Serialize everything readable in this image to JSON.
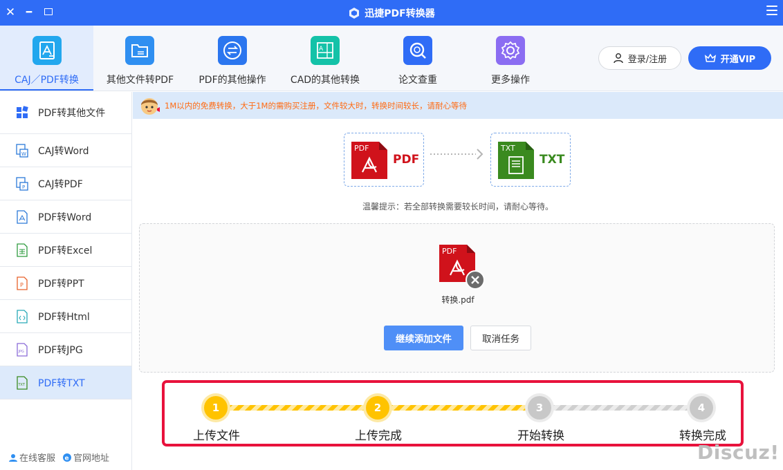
{
  "app": {
    "title": "迅捷PDF转换器"
  },
  "toolbar": {
    "tabs": [
      {
        "label": "CAJ／PDF转换",
        "icon": "caj-pdf-icon",
        "active": true
      },
      {
        "label": "其他文件转PDF",
        "icon": "folder-icon",
        "active": false
      },
      {
        "label": "PDF的其他操作",
        "icon": "swap-icon",
        "active": false
      },
      {
        "label": "CAD的其他转换",
        "icon": "cad-icon",
        "active": false
      },
      {
        "label": "论文查重",
        "icon": "magnifier-icon",
        "active": false
      },
      {
        "label": "更多操作",
        "icon": "gear-icon",
        "active": false
      }
    ],
    "login_label": "登录/注册",
    "vip_label": "开通VIP"
  },
  "sidebar": {
    "items": [
      {
        "label": "PDF转其他文件",
        "icon": "grid-icon",
        "active": false
      },
      {
        "label": "CAJ转Word",
        "icon": "caj-word-icon",
        "active": false
      },
      {
        "label": "CAJ转PDF",
        "icon": "caj-pdf-icon",
        "active": false
      },
      {
        "label": "PDF转Word",
        "icon": "pdf-word-icon",
        "active": false
      },
      {
        "label": "PDF转Excel",
        "icon": "pdf-excel-icon",
        "active": false
      },
      {
        "label": "PDF转PPT",
        "icon": "pdf-ppt-icon",
        "active": false
      },
      {
        "label": "PDF转Html",
        "icon": "pdf-html-icon",
        "active": false
      },
      {
        "label": "PDF转JPG",
        "icon": "pdf-jpg-icon",
        "active": false
      },
      {
        "label": "PDF转TXT",
        "icon": "pdf-txt-icon",
        "active": true
      }
    ],
    "footer": {
      "service": "在线客服",
      "website": "官网地址"
    }
  },
  "notice": {
    "text": "1M以内的免费转换，大于1M的需购买注册，文件较大时，转换时间较长，请耐心等待"
  },
  "conversion": {
    "from": {
      "badge": "PDF",
      "label": "PDF",
      "color": "#d0121b"
    },
    "to": {
      "badge": "TXT",
      "label": "TXT",
      "color": "#3a8a1f"
    },
    "tip": "温馨提示：若全部转换需要较长时间，请耐心等待。"
  },
  "file": {
    "badge": "PDF",
    "name": "转换.pdf"
  },
  "actions": {
    "add_label": "继续添加文件",
    "cancel_label": "取消任务"
  },
  "progress": {
    "current_step": 2,
    "steps": [
      {
        "num": "1",
        "label": "上传文件",
        "status": "done"
      },
      {
        "num": "2",
        "label": "上传完成",
        "status": "done"
      },
      {
        "num": "3",
        "label": "开始转换",
        "status": "todo"
      },
      {
        "num": "4",
        "label": "转换完成",
        "status": "todo"
      }
    ]
  },
  "watermark": "Discuz!",
  "colors": {
    "brand": "#2f6cf6",
    "highlight": "#e8123c",
    "progress_done": "#ffc300",
    "notice_text": "#ff6a12"
  }
}
